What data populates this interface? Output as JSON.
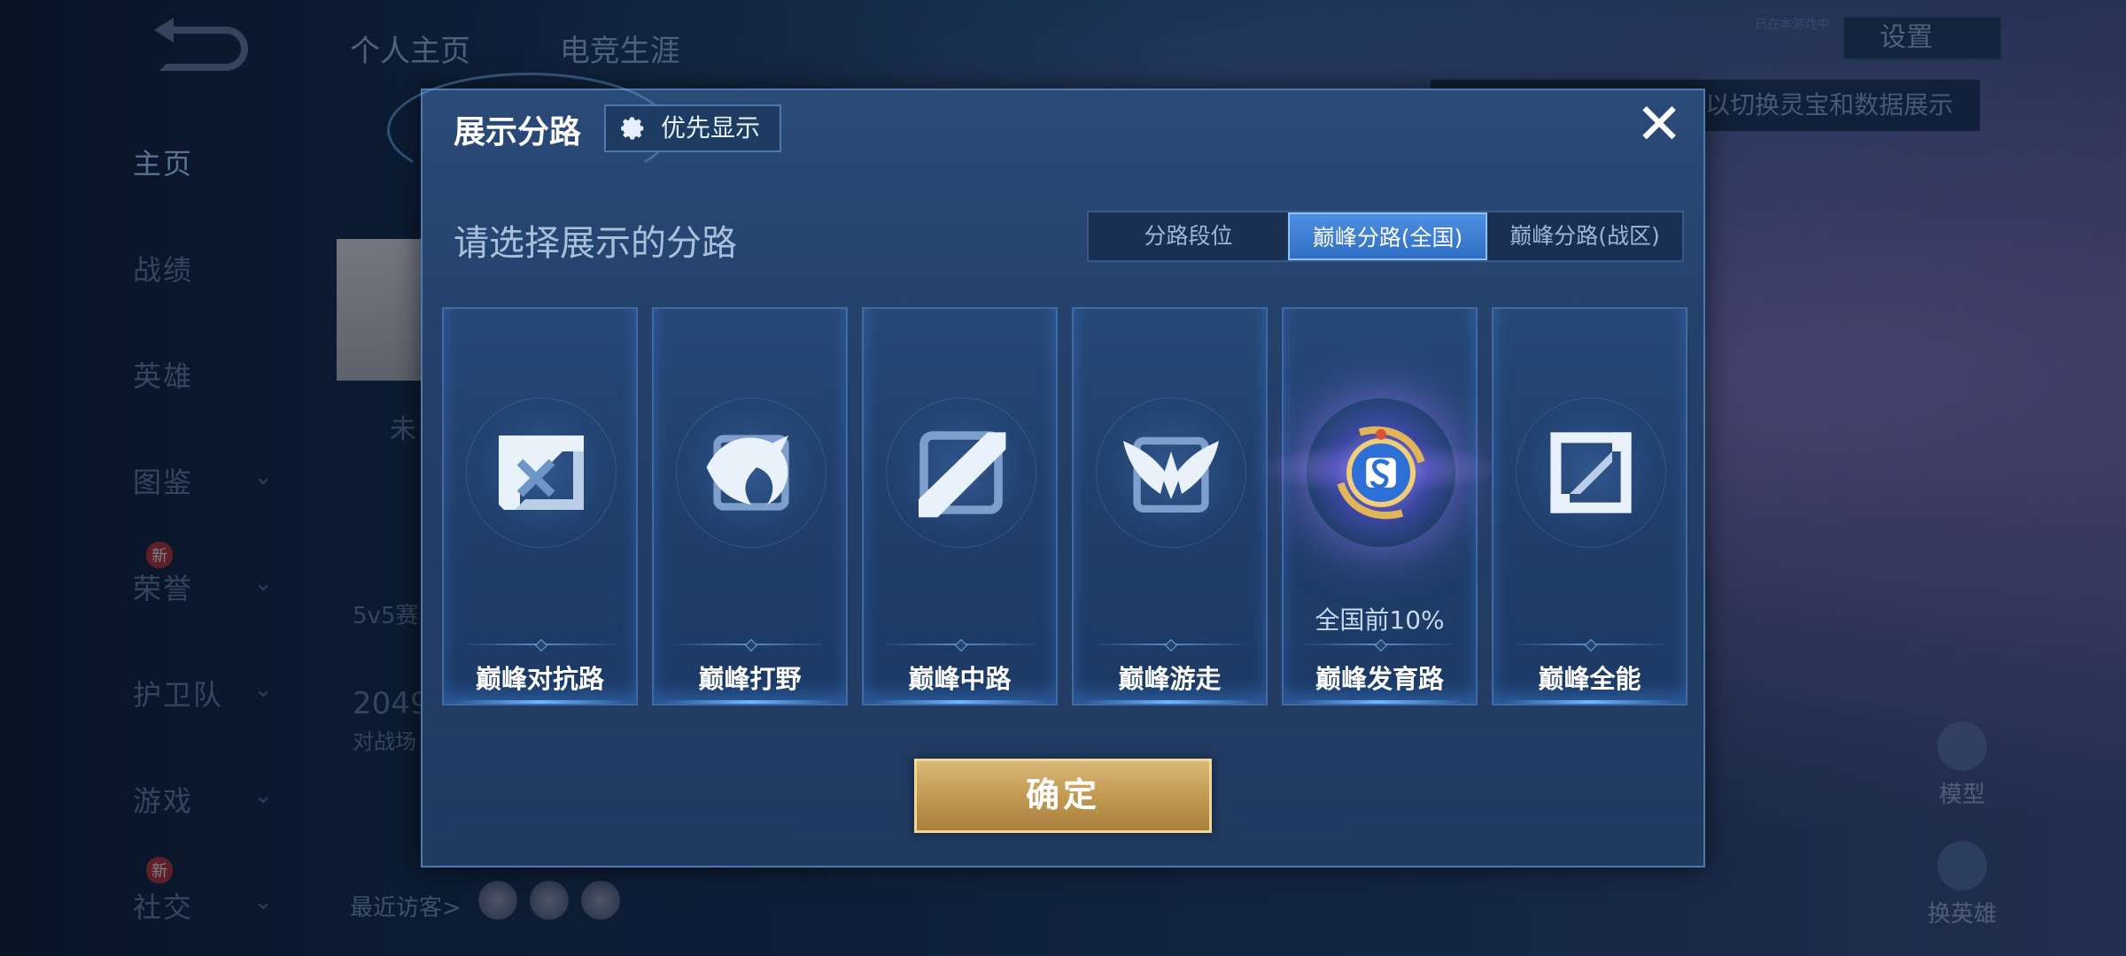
{
  "background": {
    "nav_items": [
      {
        "label": "主页",
        "active": true,
        "has_chevron": false,
        "is_new": false
      },
      {
        "label": "战绩",
        "active": false,
        "has_chevron": false,
        "is_new": false
      },
      {
        "label": "英雄",
        "active": false,
        "has_chevron": false,
        "is_new": false
      },
      {
        "label": "图鉴",
        "active": false,
        "has_chevron": true,
        "is_new": false
      },
      {
        "label": "荣誉",
        "active": false,
        "has_chevron": true,
        "is_new": true
      },
      {
        "label": "护卫队",
        "active": false,
        "has_chevron": true,
        "is_new": false
      },
      {
        "label": "游戏",
        "active": false,
        "has_chevron": true,
        "is_new": false
      },
      {
        "label": "社交",
        "active": false,
        "has_chevron": true,
        "is_new": true
      }
    ],
    "new_badge": "新",
    "top_tab_profile": "个人主页",
    "top_tab_esports": "电竞生涯",
    "settings_label": "设置",
    "tiny_tag": "已在本游戏中",
    "hint_text": "以切换灵宝和数据展示",
    "fragment_unrated": "未",
    "fragment_5v5": "5v5赛",
    "fragment_number": "2049",
    "fragment_battle": "对战场",
    "recent_visitors": "最近访客>",
    "right_btn_model": "模型",
    "right_btn_switch_hero": "换英雄"
  },
  "modal": {
    "title": "展示分路",
    "priority_label": "优先显示",
    "close_symbol": "✕",
    "prompt": "请选择展示的分路",
    "tabs": [
      "分路段位",
      "巅峰分路(全国)",
      "巅峰分路(战区)"
    ],
    "active_tab": 1,
    "cards": [
      {
        "label": "巅峰对抗路",
        "icon": "clash-lane-icon",
        "rank": ""
      },
      {
        "label": "巅峰打野",
        "icon": "jungle-dragon-icon",
        "rank": ""
      },
      {
        "label": "巅峰中路",
        "icon": "mid-lane-icon",
        "rank": ""
      },
      {
        "label": "巅峰游走",
        "icon": "roam-wings-icon",
        "rank": ""
      },
      {
        "label": "巅峰发育路",
        "icon": "farm-lane-badge-icon",
        "rank": "全国前10%",
        "selected": true
      },
      {
        "label": "巅峰全能",
        "icon": "all-round-icon",
        "rank": ""
      }
    ],
    "confirm_label": "确定"
  },
  "colors": {
    "modal_bg": "#233f68",
    "accent_blue": "#4d8fe0",
    "gold_button": "#c39a52"
  }
}
